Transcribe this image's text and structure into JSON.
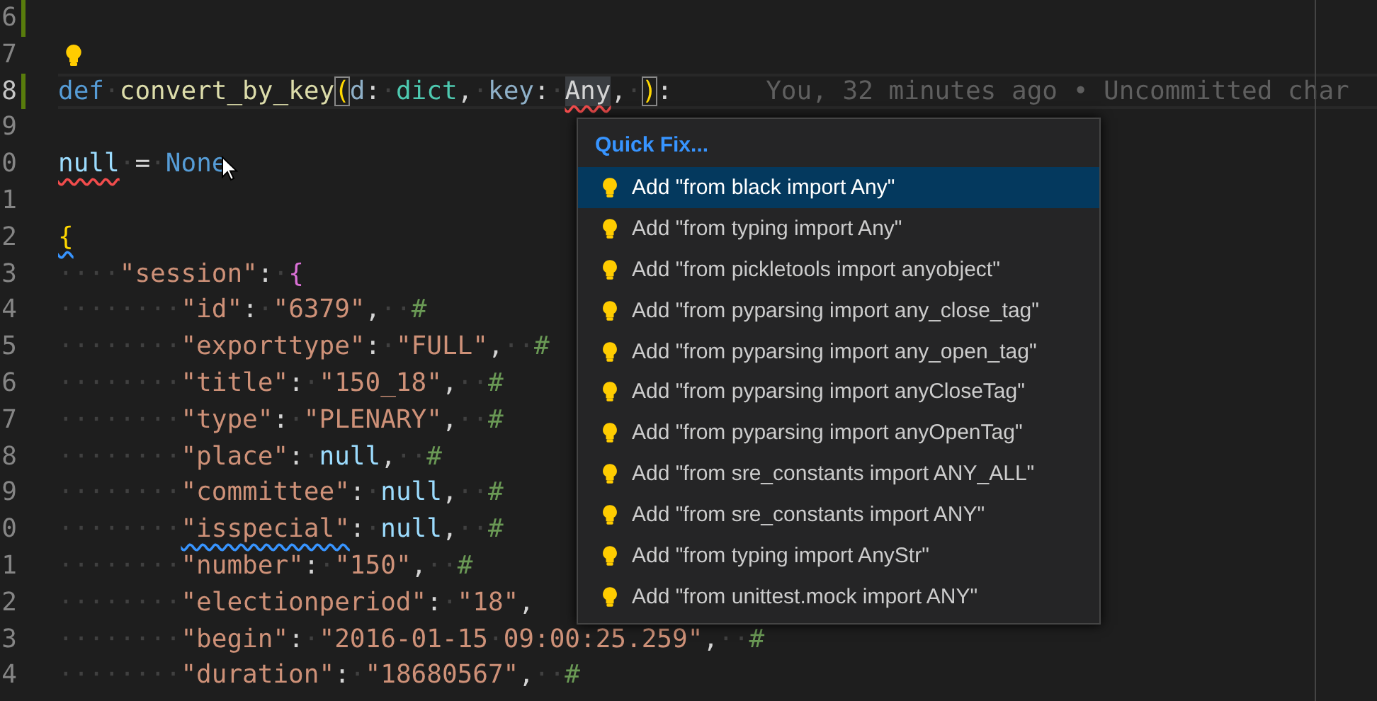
{
  "editor": {
    "lines": [
      {
        "number": "6",
        "modified": true
      },
      {
        "number": "7",
        "lightbulb": true
      },
      {
        "number": "8",
        "modified": true,
        "current": true,
        "blame": "You, 32 minutes ago • Uncommitted char",
        "tokens": [
          {
            "text": "def",
            "kind": "kw"
          },
          {
            "text": "·",
            "kind": "ws"
          },
          {
            "text": "convert_by_key",
            "kind": "fn"
          },
          {
            "text": "(",
            "kind": "bracket",
            "matched": true
          },
          {
            "text": "d",
            "kind": "param"
          },
          {
            "text": ":",
            "kind": "punc"
          },
          {
            "text": "·",
            "kind": "ws"
          },
          {
            "text": "dict",
            "kind": "type"
          },
          {
            "text": ",",
            "kind": "punc"
          },
          {
            "text": "·",
            "kind": "ws"
          },
          {
            "text": "key",
            "kind": "param"
          },
          {
            "text": ":",
            "kind": "punc"
          },
          {
            "text": "·",
            "kind": "ws"
          },
          {
            "text": "Any",
            "kind": "plain",
            "error": true,
            "highlight": true
          },
          {
            "text": ",",
            "kind": "punc"
          },
          {
            "text": "·",
            "kind": "ws"
          },
          {
            "text": ")",
            "kind": "bracket",
            "matched": true
          },
          {
            "text": ":",
            "kind": "punc"
          }
        ]
      },
      {
        "number": "9"
      },
      {
        "number": "0",
        "tokens": [
          {
            "text": "null",
            "kind": "var",
            "error": true
          },
          {
            "text": "·",
            "kind": "ws"
          },
          {
            "text": "=",
            "kind": "punc"
          },
          {
            "text": "·",
            "kind": "ws"
          },
          {
            "text": "None",
            "kind": "const"
          }
        ]
      },
      {
        "number": "1"
      },
      {
        "number": "2",
        "tokens": [
          {
            "text": "{",
            "kind": "bracket",
            "hint": true
          }
        ]
      },
      {
        "number": "3",
        "tokens": [
          {
            "text": "····",
            "kind": "ws"
          },
          {
            "text": "\"session\"",
            "kind": "str"
          },
          {
            "text": ":",
            "kind": "punc"
          },
          {
            "text": "·",
            "kind": "ws"
          },
          {
            "text": "{",
            "kind": "bracket2"
          }
        ]
      },
      {
        "number": "4",
        "tokens": [
          {
            "text": "········",
            "kind": "ws"
          },
          {
            "text": "\"id\"",
            "kind": "str"
          },
          {
            "text": ":",
            "kind": "punc"
          },
          {
            "text": "·",
            "kind": "ws"
          },
          {
            "text": "\"6379\"",
            "kind": "str"
          },
          {
            "text": ",",
            "kind": "punc"
          },
          {
            "text": "··",
            "kind": "ws"
          },
          {
            "text": "#",
            "kind": "comment"
          }
        ]
      },
      {
        "number": "5",
        "tokens": [
          {
            "text": "········",
            "kind": "ws"
          },
          {
            "text": "\"exporttype\"",
            "kind": "str"
          },
          {
            "text": ":",
            "kind": "punc"
          },
          {
            "text": "·",
            "kind": "ws"
          },
          {
            "text": "\"FULL\"",
            "kind": "str"
          },
          {
            "text": ",",
            "kind": "punc"
          },
          {
            "text": "··",
            "kind": "ws"
          },
          {
            "text": "#",
            "kind": "comment"
          }
        ]
      },
      {
        "number": "6",
        "tokens": [
          {
            "text": "········",
            "kind": "ws"
          },
          {
            "text": "\"title\"",
            "kind": "str"
          },
          {
            "text": ":",
            "kind": "punc"
          },
          {
            "text": "·",
            "kind": "ws"
          },
          {
            "text": "\"150_18\"",
            "kind": "str"
          },
          {
            "text": ",",
            "kind": "punc"
          },
          {
            "text": "··",
            "kind": "ws"
          },
          {
            "text": "#",
            "kind": "comment"
          }
        ]
      },
      {
        "number": "7",
        "tokens": [
          {
            "text": "········",
            "kind": "ws"
          },
          {
            "text": "\"type\"",
            "kind": "str"
          },
          {
            "text": ":",
            "kind": "punc"
          },
          {
            "text": "·",
            "kind": "ws"
          },
          {
            "text": "\"PLENARY\"",
            "kind": "str"
          },
          {
            "text": ",",
            "kind": "punc"
          },
          {
            "text": "··",
            "kind": "ws"
          },
          {
            "text": "#",
            "kind": "comment"
          }
        ]
      },
      {
        "number": "8",
        "tokens": [
          {
            "text": "········",
            "kind": "ws"
          },
          {
            "text": "\"place\"",
            "kind": "str"
          },
          {
            "text": ":",
            "kind": "punc"
          },
          {
            "text": "·",
            "kind": "ws"
          },
          {
            "text": "null",
            "kind": "var"
          },
          {
            "text": ",",
            "kind": "punc"
          },
          {
            "text": "··",
            "kind": "ws"
          },
          {
            "text": "#",
            "kind": "comment"
          }
        ]
      },
      {
        "number": "9",
        "tokens": [
          {
            "text": "········",
            "kind": "ws"
          },
          {
            "text": "\"committee\"",
            "kind": "str"
          },
          {
            "text": ":",
            "kind": "punc"
          },
          {
            "text": "·",
            "kind": "ws"
          },
          {
            "text": "null",
            "kind": "var"
          },
          {
            "text": ",",
            "kind": "punc"
          },
          {
            "text": "··",
            "kind": "ws"
          },
          {
            "text": "#",
            "kind": "comment"
          }
        ]
      },
      {
        "number": "0",
        "tokens": [
          {
            "text": "········",
            "kind": "ws"
          },
          {
            "text": "\"isspecial\"",
            "kind": "str",
            "hint": true
          },
          {
            "text": ":",
            "kind": "punc"
          },
          {
            "text": "·",
            "kind": "ws"
          },
          {
            "text": "null",
            "kind": "var"
          },
          {
            "text": ",",
            "kind": "punc"
          },
          {
            "text": "··",
            "kind": "ws"
          },
          {
            "text": "#",
            "kind": "comment"
          }
        ]
      },
      {
        "number": "1",
        "tokens": [
          {
            "text": "········",
            "kind": "ws"
          },
          {
            "text": "\"number\"",
            "kind": "str"
          },
          {
            "text": ":",
            "kind": "punc"
          },
          {
            "text": "·",
            "kind": "ws"
          },
          {
            "text": "\"150\"",
            "kind": "str"
          },
          {
            "text": ",",
            "kind": "punc"
          },
          {
            "text": "··",
            "kind": "ws"
          },
          {
            "text": "#",
            "kind": "comment"
          }
        ]
      },
      {
        "number": "2",
        "tokens": [
          {
            "text": "········",
            "kind": "ws"
          },
          {
            "text": "\"electionperiod\"",
            "kind": "str"
          },
          {
            "text": ":",
            "kind": "punc"
          },
          {
            "text": "·",
            "kind": "ws"
          },
          {
            "text": "\"18\"",
            "kind": "str"
          },
          {
            "text": ",",
            "kind": "punc"
          }
        ]
      },
      {
        "number": "3",
        "tokens": [
          {
            "text": "········",
            "kind": "ws"
          },
          {
            "text": "\"begin\"",
            "kind": "str"
          },
          {
            "text": ":",
            "kind": "punc"
          },
          {
            "text": "·",
            "kind": "ws"
          },
          {
            "text": "\"2016-01-15",
            "kind": "str"
          },
          {
            "text": "·",
            "kind": "ws"
          },
          {
            "text": "09:00:25.259\"",
            "kind": "str"
          },
          {
            "text": ",",
            "kind": "punc"
          },
          {
            "text": "··",
            "kind": "ws"
          },
          {
            "text": "#",
            "kind": "comment"
          }
        ]
      },
      {
        "number": "4",
        "tokens": [
          {
            "text": "········",
            "kind": "ws"
          },
          {
            "text": "\"duration\"",
            "kind": "str"
          },
          {
            "text": ":",
            "kind": "punc"
          },
          {
            "text": "·",
            "kind": "ws"
          },
          {
            "text": "\"18680567\"",
            "kind": "str"
          },
          {
            "text": ",",
            "kind": "punc"
          },
          {
            "text": "··",
            "kind": "ws"
          },
          {
            "text": "#",
            "kind": "comment"
          }
        ]
      }
    ]
  },
  "quick_fix": {
    "title": "Quick Fix...",
    "items": [
      {
        "label": "Add \"from black import Any\"",
        "selected": true
      },
      {
        "label": "Add \"from typing import Any\"",
        "selected": false
      },
      {
        "label": "Add \"from pickletools import anyobject\"",
        "selected": false
      },
      {
        "label": "Add \"from pyparsing import any_close_tag\"",
        "selected": false
      },
      {
        "label": "Add \"from pyparsing import any_open_tag\"",
        "selected": false
      },
      {
        "label": "Add \"from pyparsing import anyCloseTag\"",
        "selected": false
      },
      {
        "label": "Add \"from pyparsing import anyOpenTag\"",
        "selected": false
      },
      {
        "label": "Add \"from sre_constants import ANY_ALL\"",
        "selected": false
      },
      {
        "label": "Add \"from sre_constants import ANY\"",
        "selected": false
      },
      {
        "label": "Add \"from typing import AnyStr\"",
        "selected": false
      },
      {
        "label": "Add \"from unittest.mock import ANY\"",
        "selected": false
      }
    ]
  }
}
